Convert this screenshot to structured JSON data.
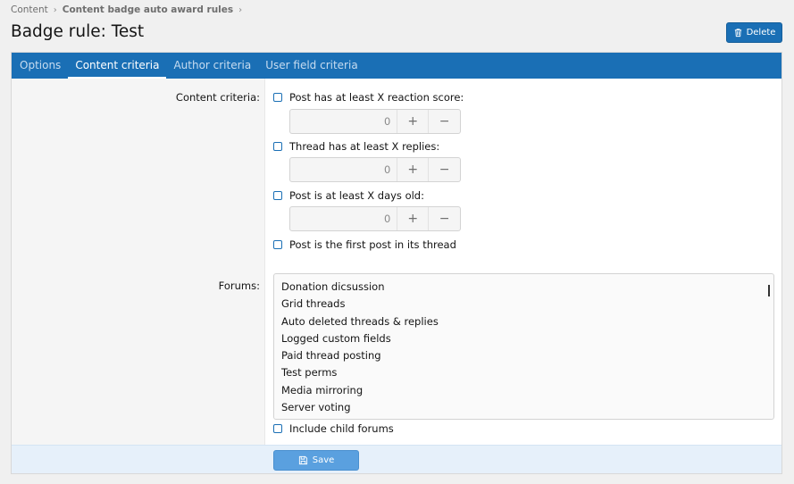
{
  "breadcrumb": {
    "items": [
      "Content",
      "Content badge auto award rules"
    ],
    "sep_icon": "chevron-right-icon"
  },
  "page": {
    "title": "Badge rule: Test",
    "delete_label": "Delete"
  },
  "tabs": [
    {
      "label": "Options"
    },
    {
      "label": "Content criteria"
    },
    {
      "label": "Author criteria"
    },
    {
      "label": "User field criteria"
    }
  ],
  "content_criteria": {
    "label": "Content criteria:",
    "options": [
      {
        "label": "Post has at least X reaction score:",
        "value": "0"
      },
      {
        "label": "Thread has at least X replies:",
        "value": "0"
      },
      {
        "label": "Post is at least X days old:",
        "value": "0"
      },
      {
        "label": "Post is the first post in its thread"
      }
    ],
    "plus": "+",
    "minus": "−"
  },
  "forums": {
    "label": "Forums:",
    "items": [
      "Donation dicsussion",
      "Grid threads",
      "Auto deleted threads & replies",
      "Logged custom fields",
      "Paid thread posting",
      "Test perms",
      "Media mirroring",
      "Server voting"
    ],
    "include_child": "Include child forums"
  },
  "footer": {
    "save_label": "Save"
  },
  "colors": {
    "accent": "#1a6fb5",
    "save": "#5aa0df",
    "page_bg": "#f0f0f0"
  }
}
